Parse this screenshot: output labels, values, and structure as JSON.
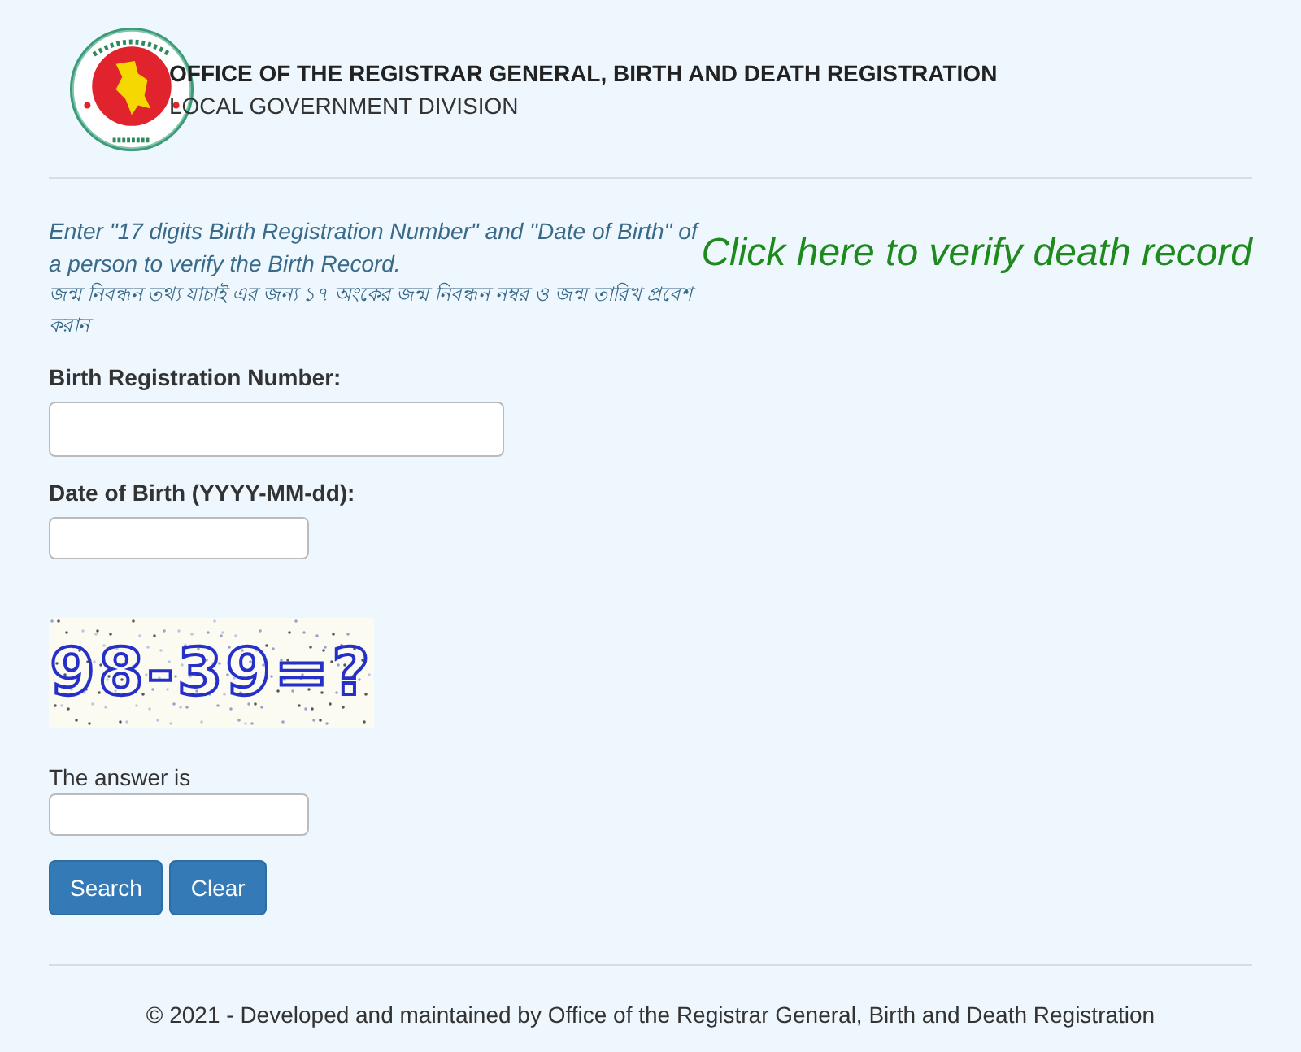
{
  "header": {
    "title": "OFFICE OF THE REGISTRAR GENERAL, BIRTH AND DEATH REGISTRATION",
    "subtitle": "LOCAL GOVERNMENT DIVISION"
  },
  "instructions": {
    "english": "Enter \"17 digits Birth Registration Number\" and \"Date of Birth\" of a person to verify the Birth Record.",
    "bangla": "জন্ম নিবন্ধন তথ্য যাচাই এর জন্য ১৭ অংকের জন্ম নিবন্ধন নম্বর ও জন্ম তারিখ প্রবেশ করান"
  },
  "death_link": "Click here to verify death record",
  "fields": [
    {
      "label": "Birth Registration Number:",
      "kind": "wide"
    },
    {
      "label": "Date of Birth (YYYY-MM-dd):",
      "kind": "narrow"
    }
  ],
  "captcha": {
    "text": "98-39=?"
  },
  "answer": {
    "label": "The answer is"
  },
  "buttons": [
    "Search",
    "Clear"
  ],
  "footer": "© 2021 - Developed and maintained by Office of the Registrar General, Birth and Death Registration"
}
